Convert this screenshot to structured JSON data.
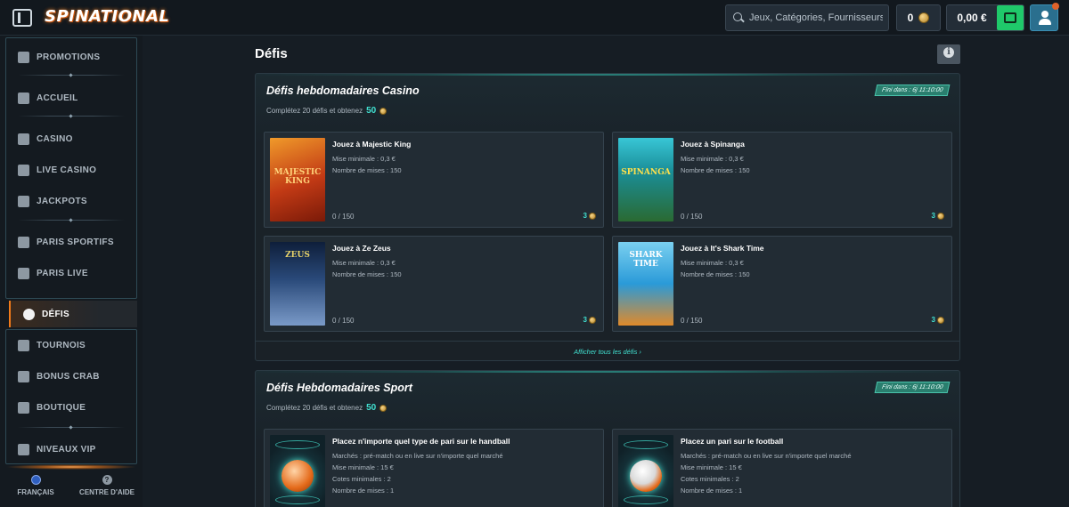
{
  "header": {
    "logo": "SPINATIONAL",
    "search_placeholder": "Jeux, Catégories, Fournisseurs",
    "coins": "0",
    "balance": "0,00 €",
    "notifications": true
  },
  "sidebar": {
    "items": [
      {
        "label": "PROMOTIONS",
        "icon": "gift-icon"
      },
      {
        "label": "ACCUEIL",
        "icon": "home-icon"
      },
      {
        "label": "CASINO",
        "icon": "slot-machine-icon"
      },
      {
        "label": "LIVE CASINO",
        "icon": "live-casino-icon"
      },
      {
        "label": "JACKPOTS",
        "icon": "jackpot-icon"
      },
      {
        "label": "PARIS SPORTIFS",
        "icon": "soccer-ball-icon"
      },
      {
        "label": "PARIS LIVE",
        "icon": "live-icon"
      },
      {
        "label": "DÉFIS",
        "icon": "medal-icon"
      },
      {
        "label": "TOURNOIS",
        "icon": "trophy-icon"
      },
      {
        "label": "BONUS CRAB",
        "icon": "crab-icon"
      },
      {
        "label": "BOUTIQUE",
        "icon": "shop-bag-icon"
      },
      {
        "label": "NIVEAUX VIP",
        "icon": "diamond-icon"
      }
    ],
    "active": "DÉFIS",
    "language": "FRANÇAIS",
    "help": "CENTRE D'AIDE"
  },
  "page": {
    "title": "Défis"
  },
  "casino_section": {
    "title": "Défis hebdomadaires Casino",
    "timer": "Fini dans : 6j 11:10:00",
    "subtitle": "Complétez 20 défis et obtenez",
    "reward": "50",
    "show_all": "Afficher tous les défis ›",
    "cards": [
      {
        "title": "Jouez à Majestic King",
        "min_bet": "Mise minimale : 0,3 €",
        "bets": "Nombre de mises : 150",
        "progress": "0 / 150",
        "reward": "3",
        "thumb_label": "MAJESTIC KING",
        "thumb_colors": [
          "#c23a15",
          "#f09a2a"
        ]
      },
      {
        "title": "Jouez à Spinanga",
        "min_bet": "Mise minimale : 0,3 €",
        "bets": "Nombre de mises : 150",
        "progress": "0 / 150",
        "reward": "3",
        "thumb_label": "SPINANGA",
        "thumb_colors": [
          "#1aa2b0",
          "#2a7a3a"
        ]
      },
      {
        "title": "Jouez à Ze Zeus",
        "min_bet": "Mise minimale : 0,3 €",
        "bets": "Nombre de mises : 150",
        "progress": "0 / 150",
        "reward": "3",
        "thumb_label": "ZEUS",
        "thumb_colors": [
          "#1a3a6a",
          "#5a7aa8"
        ]
      },
      {
        "title": "Jouez à It's Shark Time",
        "min_bet": "Mise minimale : 0,3 €",
        "bets": "Nombre de mises : 150",
        "progress": "0 / 150",
        "reward": "3",
        "thumb_label": "SHARK TIME",
        "thumb_colors": [
          "#2a9ad8",
          "#7ad0f0"
        ]
      }
    ]
  },
  "sport_section": {
    "title": "Défis Hebdomadaires Sport",
    "timer": "Fini dans : 6j 11:10:00",
    "subtitle": "Complétez 20 défis et obtenez",
    "reward": "50",
    "cards": [
      {
        "title": "Placez n'importe quel type de pari sur le handball",
        "markets": "Marchés : pré-match ou en live sur n'importe quel marché",
        "min_bet": "Mise minimale : 15 €",
        "min_odds": "Cotes minimales : 2",
        "bets": "Nombre de mises : 1"
      },
      {
        "title": "Placez un pari sur le football",
        "markets": "Marchés : pré-match ou en live sur n'importe quel marché",
        "min_bet": "Mise minimale : 15 €",
        "min_odds": "Cotes minimales : 2",
        "bets": "Nombre de mises : 1"
      }
    ]
  },
  "colors": {
    "accent_teal": "#41e0d0",
    "accent_orange": "#f07a1a",
    "wallet_green": "#1fc96a",
    "user_blue": "#2a6f8e"
  }
}
